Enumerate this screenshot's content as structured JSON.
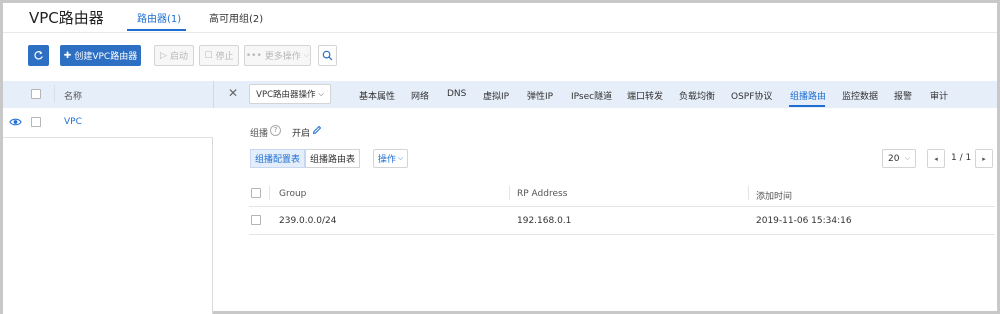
{
  "header": {
    "title": "VPC路由器",
    "tabs": [
      {
        "label": "路由器(1)",
        "active": true
      },
      {
        "label": "高可用组(2)",
        "active": false
      }
    ]
  },
  "toolbar": {
    "refresh_icon": "refresh-icon",
    "create_label": "创建VPC路由器",
    "start_label": "启动",
    "stop_label": "停止",
    "more_label": "更多操作",
    "search_icon": "search-icon"
  },
  "list": {
    "column_name": "名称",
    "rows": [
      {
        "name": "VPC"
      }
    ]
  },
  "detail": {
    "actions_label": "VPC路由器操作",
    "tabs": [
      {
        "label": "基本属性"
      },
      {
        "label": "网络"
      },
      {
        "label": "DNS"
      },
      {
        "label": "虚拟IP"
      },
      {
        "label": "弹性IP"
      },
      {
        "label": "IPsec隧道"
      },
      {
        "label": "端口转发"
      },
      {
        "label": "负载均衡"
      },
      {
        "label": "OSPF协议"
      },
      {
        "label": "组播路由",
        "active": true
      },
      {
        "label": "监控数据"
      },
      {
        "label": "报警"
      },
      {
        "label": "审计"
      }
    ],
    "multicast_label": "组播",
    "multicast_help": "?",
    "multicast_status": "开启",
    "subtabs": [
      {
        "label": "组播配置表",
        "active": true
      },
      {
        "label": "组播路由表",
        "active": false
      }
    ],
    "operation_label": "操作",
    "page_size": "20",
    "page_info": "1 / 1",
    "table": {
      "columns": [
        "Group",
        "RP Address",
        "添加时间"
      ],
      "rows": [
        {
          "group": "239.0.0.0/24",
          "rp_address": "192.168.0.1",
          "added": "2019-11-06 15:34:16"
        }
      ]
    }
  },
  "colors": {
    "accent": "#1f6fd1",
    "primary_button": "#2d6fc2",
    "list_header_bg": "#e6eef9"
  }
}
